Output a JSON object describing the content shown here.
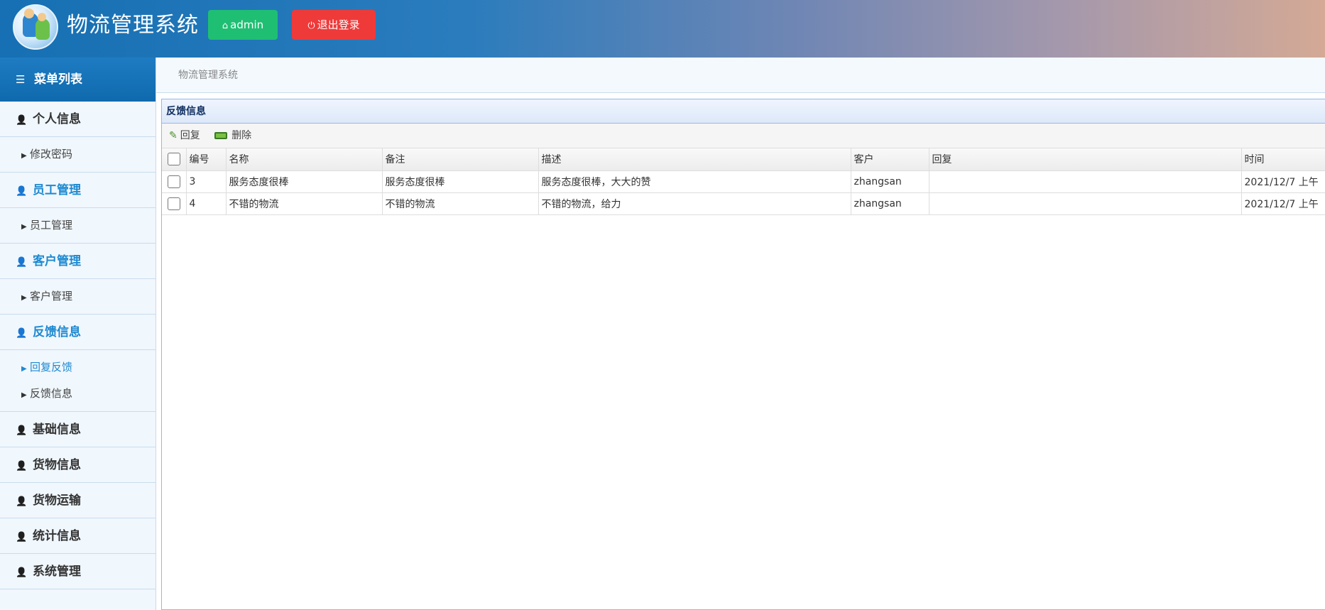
{
  "header": {
    "app_title": "物流管理系统",
    "admin_label": "admin",
    "logout_label": "退出登录"
  },
  "sidebar": {
    "menu_title": "菜单列表",
    "groups": [
      {
        "label": "个人信息",
        "active": false,
        "items": [
          {
            "label": "修改密码",
            "active": false
          }
        ]
      },
      {
        "label": "员工管理",
        "active": true,
        "items": [
          {
            "label": "员工管理",
            "active": false
          }
        ]
      },
      {
        "label": "客户管理",
        "active": true,
        "items": [
          {
            "label": "客户管理",
            "active": false
          }
        ]
      },
      {
        "label": "反馈信息",
        "active": true,
        "items": [
          {
            "label": "回复反馈",
            "active": true
          },
          {
            "label": "反馈信息",
            "active": false
          }
        ]
      },
      {
        "label": "基础信息",
        "active": false,
        "items": []
      },
      {
        "label": "货物信息",
        "active": false,
        "items": []
      },
      {
        "label": "货物运输",
        "active": false,
        "items": []
      },
      {
        "label": "统计信息",
        "active": false,
        "items": []
      },
      {
        "label": "系统管理",
        "active": false,
        "items": []
      }
    ]
  },
  "breadcrumb": "物流管理系统",
  "panel": {
    "title": "反馈信息",
    "toolbar": {
      "reply_label": "回复",
      "delete_label": "删除"
    },
    "columns": [
      "编号",
      "名称",
      "备注",
      "描述",
      "客户",
      "回复",
      "时间"
    ],
    "rows": [
      {
        "id": "3",
        "name": "服务态度很棒",
        "remark": "服务态度很棒",
        "desc": "服务态度很棒，大大的赞",
        "customer": "zhangsan",
        "reply": "",
        "time": "2021/12/7 上午"
      },
      {
        "id": "4",
        "name": "不错的物流",
        "remark": "不错的物流",
        "desc": "不错的物流，给力",
        "customer": "zhangsan",
        "reply": "",
        "time": "2021/12/7 上午"
      }
    ]
  },
  "colors": {
    "header_blue": "#1670b3",
    "admin_green": "#1fbf73",
    "logout_red": "#ef3a3a",
    "active_blue": "#1e8ad1"
  },
  "icons": {
    "admin": "home-icon",
    "logout": "power-icon",
    "menu": "list-icon",
    "group": "user-icon",
    "sub": "caret-right-icon",
    "reply": "pencil-icon",
    "delete": "battery-icon"
  }
}
